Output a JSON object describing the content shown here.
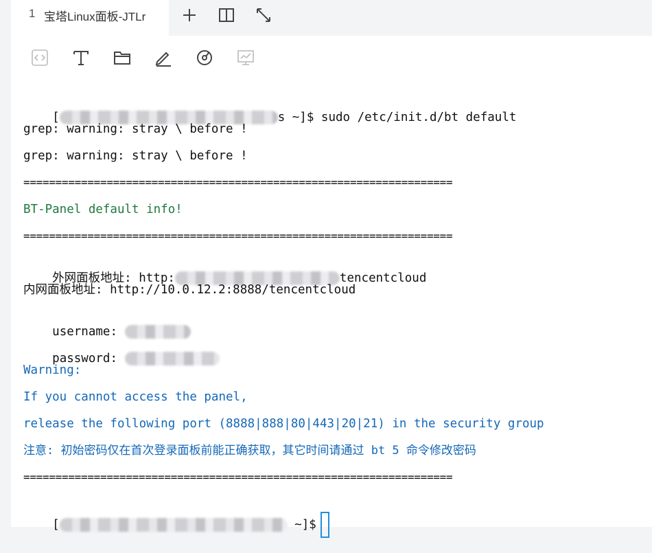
{
  "tab": {
    "number": "1",
    "title": "宝塔Linux面板-JTLr"
  },
  "tabbar_icons": [
    "plus-icon",
    "split-view-icon",
    "expand-icon"
  ],
  "toolbar_icons": [
    "code-icon",
    "text-icon",
    "folder-icon",
    "edit-icon",
    "monitor-gauge-icon",
    "chart-icon"
  ],
  "terminal": {
    "cmd_prefix": "[",
    "cmd_mid": "s ~]$ sudo /etc/init.d/bt default",
    "grep1": "grep: warning: stray \\ before !",
    "grep2": "grep: warning: stray \\ before !",
    "sep": "===================================================================",
    "info": "BT-Panel default info!",
    "ext_label": "外网面板地址: http:",
    "ext_tail": "tencentcloud",
    "int_line": "内网面板地址: http://10.0.12.2:8888/tencentcloud",
    "username_label": "username: ",
    "password_label": "password: ",
    "warning": "Warning:",
    "if_line": "If you cannot access the panel,",
    "release_line": "release the following port (8888|888|80|443|20|21) in the security group",
    "note_line": "注意: 初始密码仅在首次登录面板前能正确获取，其它时间请通过 bt 5 命令修改密码",
    "prompt_prefix": "[",
    "prompt_tail": " ~]$"
  },
  "colors": {
    "info": "#1e7a3d",
    "warning": "#1468b8",
    "cursor": "#1f8fe0"
  }
}
